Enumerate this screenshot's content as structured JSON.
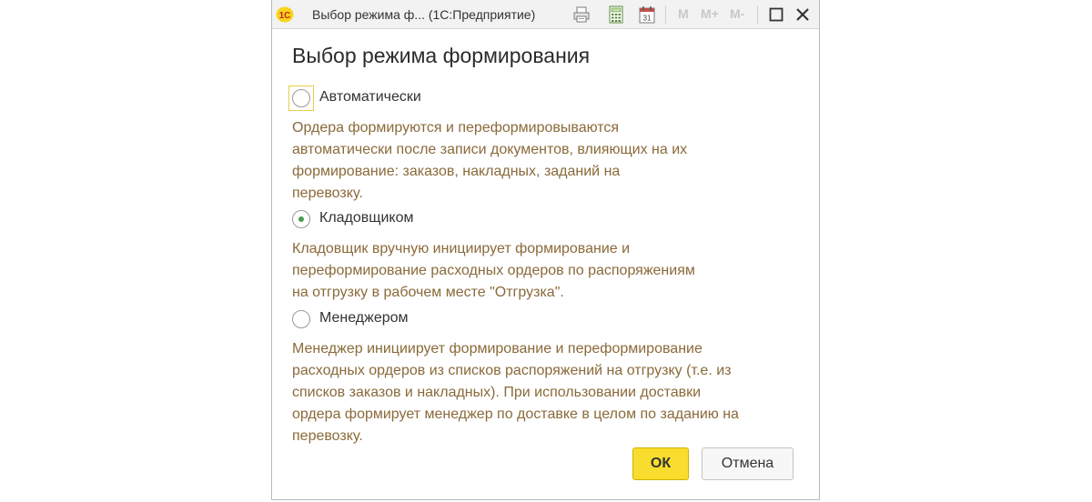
{
  "window": {
    "title": "Выбор режима ф...  (1С:Предприятие)",
    "logo": "1С",
    "memory_buttons": [
      "M",
      "M+",
      "M-"
    ]
  },
  "dialog": {
    "title": "Выбор режима формирования"
  },
  "options": [
    {
      "label": "Автоматически",
      "selected": false,
      "description": "Ордера формируются и переформировываются\nавтоматически после записи документов, влияющих на их\nформирование: заказов, накладных, заданий на\nперевозку."
    },
    {
      "label": "Кладовщиком",
      "selected": true,
      "description": "Кладовщик вручную инициирует формирование и\nпереформирование расходных ордеров по распоряжениям\nна отгрузку в рабочем месте \"Отгрузка\"."
    },
    {
      "label": "Менеджером",
      "selected": false,
      "description": "Менеджер инициирует формирование и переформирование\nрасходных ордеров из списков распоряжений на отгрузку (т.е. из\nсписков заказов и накладных). При использовании доставки\nордера формирует менеджер по доставке в целом по заданию на\nперевозку."
    }
  ],
  "buttons": {
    "ok": "ОК",
    "cancel": "Отмена"
  },
  "toolbar": {
    "calendar_day": "31"
  },
  "colors": {
    "accent_yellow": "#f8dc2e",
    "description_text": "#8a6a3a",
    "radio_selected": "#4b9a4b",
    "focus_border": "#e8cd45"
  }
}
